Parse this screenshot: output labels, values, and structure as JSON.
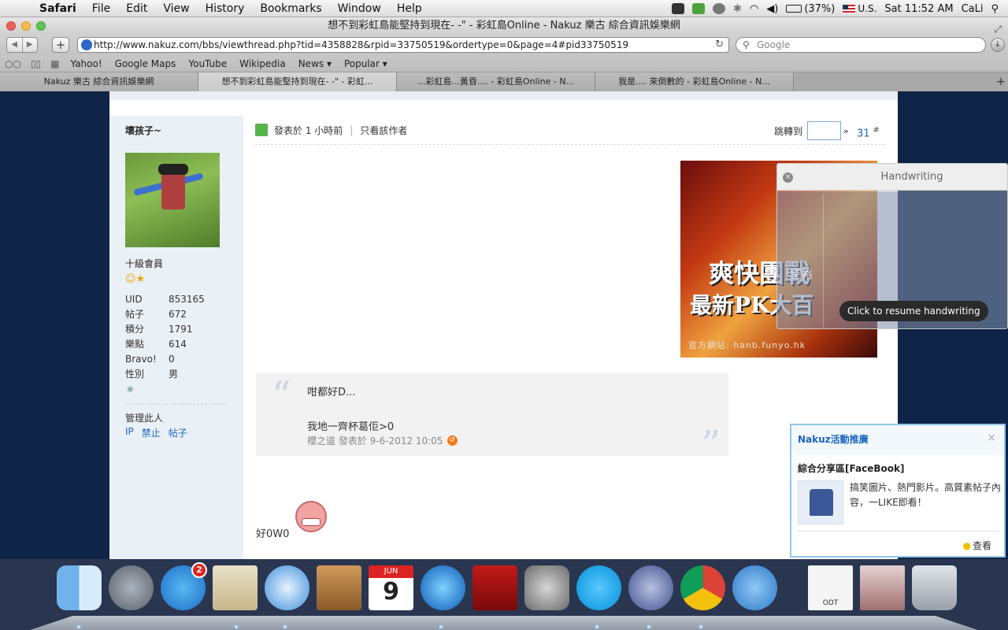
{
  "menubar": {
    "app": "Safari",
    "items": [
      "File",
      "Edit",
      "View",
      "History",
      "Bookmarks",
      "Window",
      "Help"
    ],
    "battery": "(37%)",
    "input_source": "U.S.",
    "clock": "Sat 11:52 AM",
    "user": "CaLi"
  },
  "window": {
    "title": "想不到彩虹島能堅持到現在- -\" - 彩虹島Online - Nakuz 樂古 綜合資訊娛樂網"
  },
  "toolbar": {
    "url": "http://www.nakuz.com/bbs/viewthread.php?tid=4358828&rpid=33750519&ordertype=0&page=4#pid33750519",
    "search_placeholder": "Google"
  },
  "bookmarks": [
    "Yahoo!",
    "Google Maps",
    "YouTube",
    "Wikipedia",
    "News ▾",
    "Popular ▾"
  ],
  "tabs": [
    "Nakuz 樂古 綜合資訊娛樂網",
    "想不到彩虹島能堅持到現在- -\" - 彩虹...",
    "...彩虹島...黃昏.... - 彩虹島Online - N...",
    "我是.... 來倒數的 - 彩虹島Online - N..."
  ],
  "sidebar": {
    "username": "壞孩子~",
    "rank": "十級會員",
    "stats": [
      {
        "k": "UID",
        "v": "853165"
      },
      {
        "k": "帖子",
        "v": "672"
      },
      {
        "k": "積分",
        "v": "1791"
      },
      {
        "k": "樂點",
        "v": "614"
      },
      {
        "k": "Bravo!",
        "v": "0"
      },
      {
        "k": "性別",
        "v": "男"
      }
    ],
    "manage_label": "管理此人",
    "manage_links": [
      "IP",
      "禁止",
      "帖子"
    ]
  },
  "post": {
    "posted": "發表於 1 小時前",
    "author_only": "只看該作者",
    "jump_label": "跳轉到",
    "jump_arrow": "»",
    "floor": "31",
    "floor_suffix": "#",
    "quote_line1": "咁都好D...",
    "quote_line2": "我地一齊杯葛佢>0",
    "quote_meta": "櫻之道 發表於 9-6-2012 10:05",
    "reply_text": "好0W0"
  },
  "ad": {
    "line1": "爽快團戰",
    "line2": "最新PK大百",
    "site": "官方網站: hanb.funyo.hk"
  },
  "handwriting": {
    "title": "Handwriting",
    "space": "空格",
    "resume": "Click to resume handwriting"
  },
  "promo": {
    "header": "Nakuz活動推廣",
    "title": "綜合分享區[FaceBook]",
    "desc": "搞笑圖片、熱門影片。高質素帖子內容，一LIKE即看！",
    "view": "查看"
  },
  "dock": {
    "appstore_badge": "2",
    "calendar_month": "JUN",
    "calendar_day": "9",
    "odt_label": "ODT"
  },
  "colors": {
    "link": "#1b64c0",
    "sidebar_bg": "#e9f0f6",
    "desktop_bg": "#0f2446"
  }
}
